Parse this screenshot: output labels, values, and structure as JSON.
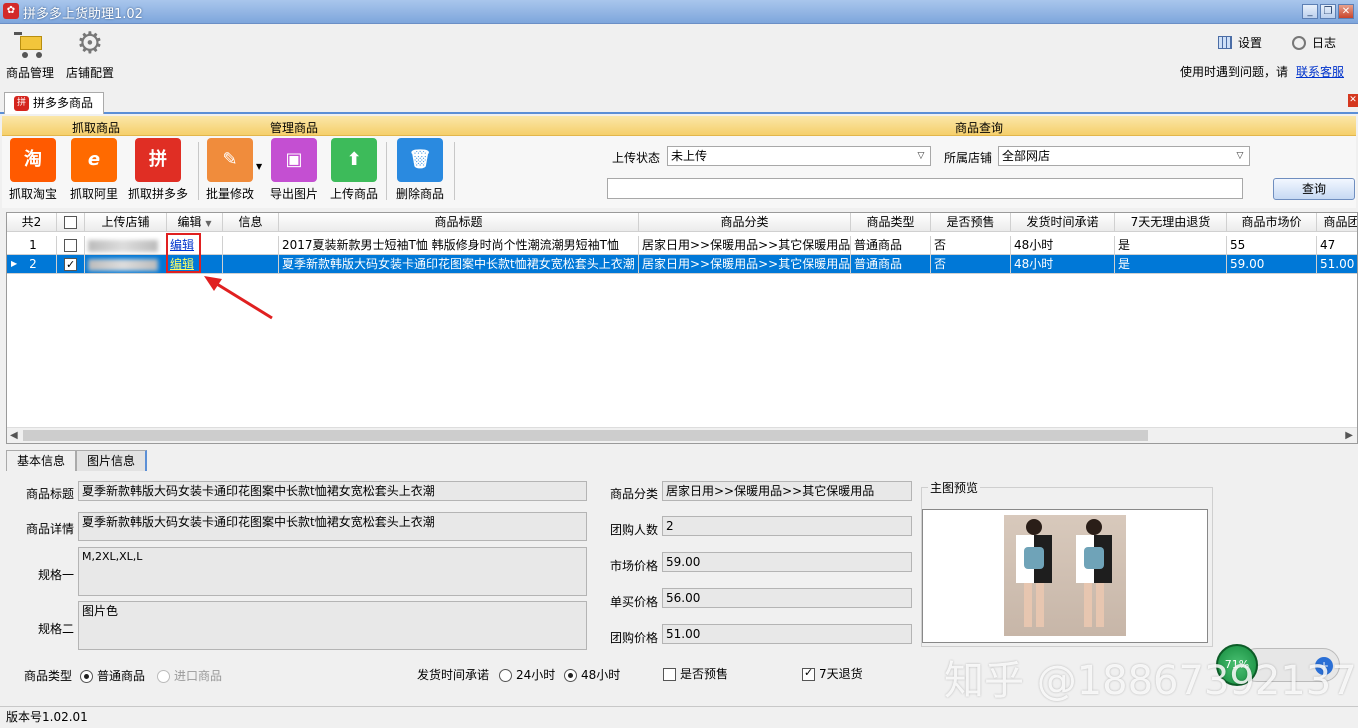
{
  "window": {
    "title": "拼多多上货助理1.02"
  },
  "toolbar": {
    "product_mgmt": "商品管理",
    "store_config": "店铺配置",
    "settings": "设置",
    "log": "日志",
    "help_text": "使用时遇到问题，请",
    "contact": "联系客服"
  },
  "doc_tab": {
    "label": "拼多多商品"
  },
  "ribbon": {
    "group_fetch": "抓取商品",
    "group_manage": "管理商品",
    "group_query": "商品查询",
    "buttons": {
      "taobao": "抓取淘宝",
      "ali": "抓取阿里",
      "pdd": "抓取拼多多",
      "batch_edit": "批量修改",
      "export_img": "导出图片",
      "upload": "上传商品",
      "delete": "删除商品"
    },
    "icons": {
      "taobao": "淘",
      "ali": "e",
      "pdd": "拼"
    },
    "upload_status_label": "上传状态",
    "upload_status_value": "未上传",
    "store_label": "所属店铺",
    "store_value": "全部网店",
    "query_button": "查询"
  },
  "grid": {
    "headers": [
      "共2",
      "",
      "上传店铺",
      "编辑",
      "信息",
      "商品标题",
      "商品分类",
      "商品类型",
      "是否预售",
      "发货时间承诺",
      "7天无理由退货",
      "商品市场价",
      "商品团"
    ],
    "rows": [
      {
        "num": "1",
        "checked": false,
        "edit": "编辑",
        "info": "",
        "title": "2017夏装新款男士短袖T恤 韩版修身时尚个性潮流潮男短袖T恤",
        "category": "居家日用>>保暖用品>>其它保暖用品",
        "type": "普通商品",
        "presale": "否",
        "ship": "48小时",
        "return7": "是",
        "market_price": "55",
        "group_price": "47"
      },
      {
        "num": "2",
        "checked": true,
        "edit": "编辑",
        "info": "",
        "title": "夏季新款韩版大码女装卡通印花图案中长款t恤裙女宽松套头上衣潮",
        "category": "居家日用>>保暖用品>>其它保暖用品",
        "type": "普通商品",
        "presale": "否",
        "ship": "48小时",
        "return7": "是",
        "market_price": "59.00",
        "group_price": "51.00"
      }
    ]
  },
  "bottom_tabs": {
    "basic": "基本信息",
    "images": "图片信息"
  },
  "detail": {
    "title_label": "商品标题",
    "title_value": "夏季新款韩版大码女装卡通印花图案中长款t恤裙女宽松套头上衣潮",
    "desc_label": "商品详情",
    "desc_value": "夏季新款韩版大码女装卡通印花图案中长款t恤裙女宽松套头上衣潮",
    "spec1_label": "规格一",
    "spec1_value": "M,2XL,XL,L",
    "spec2_label": "规格二",
    "spec2_value": "图片色",
    "category_label": "商品分类",
    "category_value": "居家日用>>保暖用品>>其它保暖用品",
    "group_count_label": "团购人数",
    "group_count_value": "2",
    "market_label": "市场价格",
    "market_value": "59.00",
    "single_label": "单买价格",
    "single_value": "56.00",
    "group_price_label": "团购价格",
    "group_price_value": "51.00",
    "preview_label": "主图预览",
    "type_label": "商品类型",
    "type_normal": "普通商品",
    "type_import": "进口商品",
    "ship_label": "发货时间承诺",
    "ship_24": "24小时",
    "ship_48": "48小时",
    "presale_label": "是否预售",
    "return_label": "7天退货"
  },
  "status": {
    "version": "版本号1.02.01"
  },
  "overlay": {
    "watermark": "知乎 @18867392137",
    "ball": "71%"
  },
  "colors": {
    "selection": "#0078d7",
    "ribbon_header": "#f5cf6b",
    "annotation": "#e02020"
  }
}
